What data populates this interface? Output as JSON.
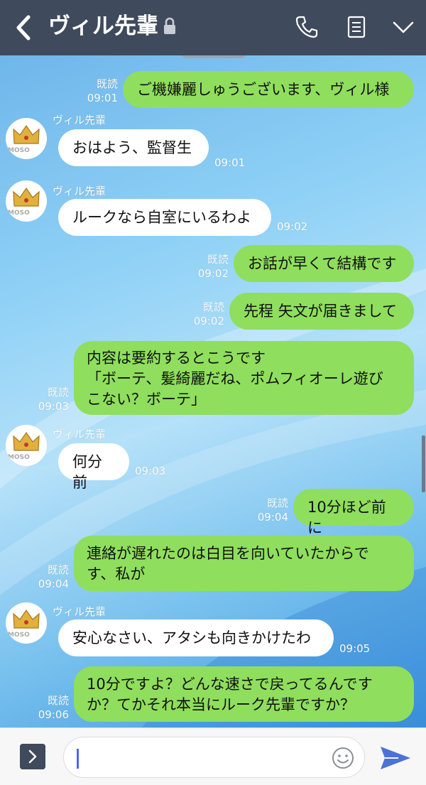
{
  "header": {
    "title": "ヴィル先輩",
    "icons": [
      "back-icon",
      "lock-icon",
      "phone-icon",
      "notes-icon",
      "chevron-down-icon"
    ]
  },
  "colors": {
    "header": "#3f4a5c",
    "outgoing": "#8fde5d",
    "incoming": "#ffffff"
  },
  "messages": [
    {
      "dir": "out",
      "text": "ご機嫌麗しゅうございます、ヴィル様",
      "read": "既読",
      "time": "09:01"
    },
    {
      "dir": "in",
      "sender": "ヴィル先輩",
      "avatar_mark": "MOSO",
      "text": "おはよう、監督生",
      "time": "09:01"
    },
    {
      "dir": "in",
      "sender": "ヴィル先輩",
      "avatar_mark": "MOSO",
      "text": "ルークなら自室にいるわよ",
      "time": "09:02"
    },
    {
      "dir": "out",
      "text": "お話が早くて結構です",
      "read": "既読",
      "time": "09:02"
    },
    {
      "dir": "out",
      "text": "先程 矢文が届きまして",
      "read": "既読",
      "time": "09:02"
    },
    {
      "dir": "out",
      "text": "内容は要約するとこうです\n「ボーテ、髪綺麗だね、ポムフィオーレ遊び\nこない？ボーテ」",
      "read": "既読",
      "time": "09:03"
    },
    {
      "dir": "in",
      "sender": "ヴィル先輩",
      "avatar_mark": "MOSO",
      "text": "何分前",
      "time": "09:03"
    },
    {
      "dir": "out",
      "text": "10分ほど前に",
      "read": "既読",
      "time": "09:04"
    },
    {
      "dir": "out",
      "text": "連絡が遅れたのは白目を向いていたからで\nす、私が",
      "read": "既読",
      "time": "09:04"
    },
    {
      "dir": "in",
      "sender": "ヴィル先輩",
      "avatar_mark": "MOSO",
      "text": "安心なさい、アタシも向きかけたわ",
      "time": "09:05"
    },
    {
      "dir": "out",
      "text": "10分ですよ？どんな速さで戻ってるんです\nか？てかそれ本当にルーク先輩ですか？",
      "read": "既読",
      "time": "09:06"
    }
  ],
  "footer": {
    "input_value": "",
    "icons": [
      "expand-icon",
      "emoji-icon",
      "send-icon"
    ]
  }
}
